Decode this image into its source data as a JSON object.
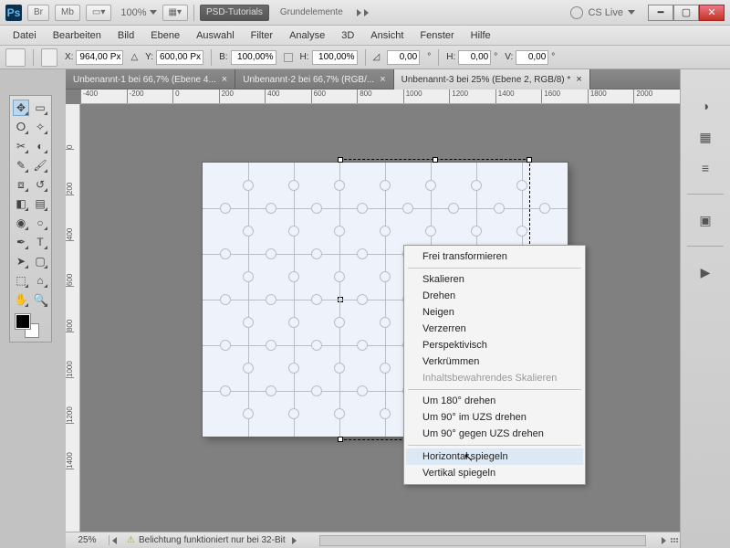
{
  "titlebar": {
    "br_label": "Br",
    "mb_label": "Mb",
    "zoom": "100%",
    "tutorials": "PSD-Tutorials",
    "grundelemente": "Grundelemente",
    "cslive": "CS Live"
  },
  "menu": [
    "Datei",
    "Bearbeiten",
    "Bild",
    "Ebene",
    "Auswahl",
    "Filter",
    "Analyse",
    "3D",
    "Ansicht",
    "Fenster",
    "Hilfe"
  ],
  "options": {
    "x_label": "X:",
    "x_val": "964,00 Px",
    "y_label": "Y:",
    "y_val": "600,00 Px",
    "b_label": "B:",
    "b_val": "100,00%",
    "h_label": "H:",
    "h_val": "100,00%",
    "ang_val": "0,00",
    "h2_label": "H:",
    "h2_val": "0,00",
    "v_label": "V:",
    "v_val": "0,00"
  },
  "tabs": [
    {
      "label": "Unbenannt-1 bei 66,7% (Ebene 4...",
      "active": false
    },
    {
      "label": "Unbenannt-2 bei 66,7% (RGB/...",
      "active": false
    },
    {
      "label": "Unbenannt-3 bei 25% (Ebene 2, RGB/8) *",
      "active": true
    }
  ],
  "ruler_h": [
    "-400",
    "-200",
    "0",
    "200",
    "400",
    "600",
    "800",
    "1000",
    "1200",
    "1400",
    "1600",
    "1800",
    "2000"
  ],
  "ruler_v": [
    "0",
    "200",
    "400",
    "600",
    "800",
    "1000",
    "1200",
    "1400"
  ],
  "tools": [
    {
      "name": "move-tool",
      "g": "✥"
    },
    {
      "name": "marquee-tool",
      "g": "▭"
    },
    {
      "name": "lasso-tool",
      "g": "ⵔ"
    },
    {
      "name": "magic-wand-tool",
      "g": "✧"
    },
    {
      "name": "crop-tool",
      "g": "✂"
    },
    {
      "name": "eyedropper-tool",
      "g": "◐"
    },
    {
      "name": "healing-brush-tool",
      "g": "✎"
    },
    {
      "name": "brush-tool",
      "g": "🖌"
    },
    {
      "name": "stamp-tool",
      "g": "⧈"
    },
    {
      "name": "history-brush-tool",
      "g": "↺"
    },
    {
      "name": "eraser-tool",
      "g": "◧"
    },
    {
      "name": "gradient-tool",
      "g": "▤"
    },
    {
      "name": "blur-tool",
      "g": "◉"
    },
    {
      "name": "dodge-tool",
      "g": "○"
    },
    {
      "name": "pen-tool",
      "g": "✒"
    },
    {
      "name": "type-tool",
      "g": "T"
    },
    {
      "name": "path-select-tool",
      "g": "➤"
    },
    {
      "name": "shape-tool",
      "g": "▢"
    },
    {
      "name": "3d-tool",
      "g": "⬚"
    },
    {
      "name": "3d-camera-tool",
      "g": "⌂"
    },
    {
      "name": "hand-tool",
      "g": "✋"
    },
    {
      "name": "zoom-tool",
      "g": "🔍"
    }
  ],
  "context_menu": [
    {
      "label": "Frei transformieren",
      "type": "item"
    },
    {
      "type": "sep"
    },
    {
      "label": "Skalieren",
      "type": "item"
    },
    {
      "label": "Drehen",
      "type": "item"
    },
    {
      "label": "Neigen",
      "type": "item"
    },
    {
      "label": "Verzerren",
      "type": "item"
    },
    {
      "label": "Perspektivisch",
      "type": "item"
    },
    {
      "label": "Verkrümmen",
      "type": "item"
    },
    {
      "label": "Inhaltsbewahrendes Skalieren",
      "type": "item",
      "disabled": true
    },
    {
      "type": "sep"
    },
    {
      "label": "Um 180° drehen",
      "type": "item"
    },
    {
      "label": "Um 90° im UZS drehen",
      "type": "item"
    },
    {
      "label": "Um 90° gegen UZS drehen",
      "type": "item"
    },
    {
      "type": "sep"
    },
    {
      "label": "Horizontal spiegeln",
      "type": "item",
      "hover": true
    },
    {
      "label": "Vertikal spiegeln",
      "type": "item"
    }
  ],
  "status": {
    "zoom": "25%",
    "msg": "Belichtung funktioniert nur bei 32-Bit"
  },
  "right_icons": [
    "color-icon",
    "swatches-icon",
    "adjust-icon",
    "masks-icon",
    "play-icon"
  ]
}
